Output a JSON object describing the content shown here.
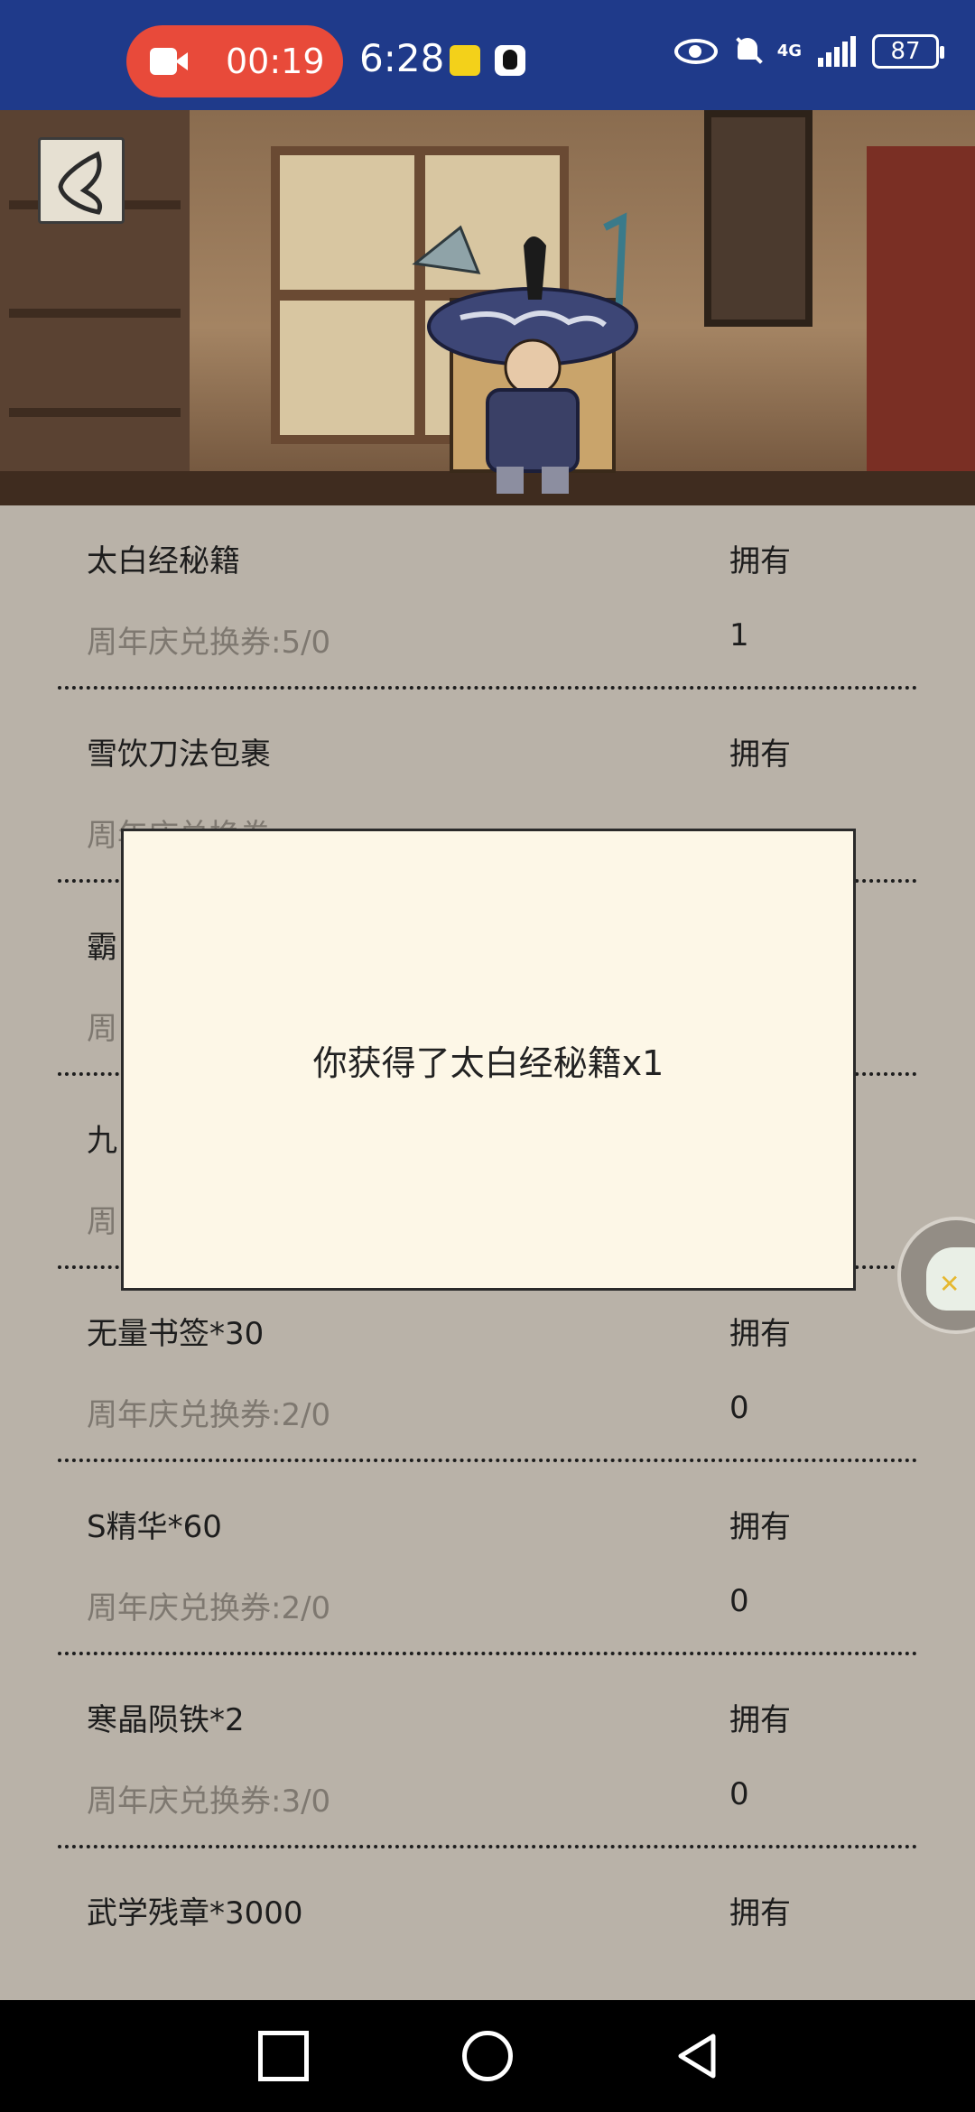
{
  "status_bar": {
    "recording_time": "00:19",
    "clock": "6:28",
    "network": "4G",
    "battery": "87"
  },
  "icons": {
    "back": "back-chevron-icon",
    "record": "video-record-icon",
    "float": "game-assistant-icon"
  },
  "items": [
    {
      "name": "太白经秘籍",
      "own_label": "拥有",
      "cost": "周年庆兑换券:5/0",
      "owned": "1"
    },
    {
      "name": "雪饮刀法包裹",
      "own_label": "拥有",
      "cost": "周年庆兑换券:",
      "owned": ""
    },
    {
      "name": "霸",
      "own_label": "",
      "cost": "周",
      "owned": ""
    },
    {
      "name": "九",
      "own_label": "",
      "cost": "周",
      "owned": ""
    },
    {
      "name": "无量书签*30",
      "own_label": "拥有",
      "cost": "周年庆兑换券:2/0",
      "owned": "0"
    },
    {
      "name": "S精华*60",
      "own_label": "拥有",
      "cost": "周年庆兑换券:2/0",
      "owned": "0"
    },
    {
      "name": "寒晶陨铁*2",
      "own_label": "拥有",
      "cost": "周年庆兑换券:3/0",
      "owned": "0"
    },
    {
      "name": "武学残章*3000",
      "own_label": "拥有",
      "cost": "",
      "owned": ""
    }
  ],
  "modal": {
    "message": "你获得了太白经秘籍x1"
  },
  "colors": {
    "status_bar": "#1f3a8a",
    "record_pill": "#e84a3a",
    "page_bg": "#b9b2a8",
    "modal_bg": "#fdf7e7"
  }
}
